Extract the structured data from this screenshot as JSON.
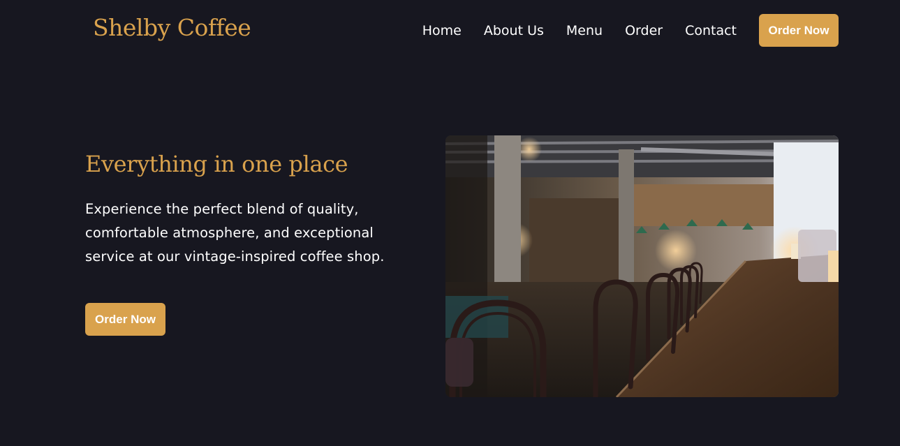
{
  "header": {
    "logo_text": "Shelby Coffee",
    "nav_items": [
      {
        "label": "Home"
      },
      {
        "label": "About Us"
      },
      {
        "label": "Menu"
      },
      {
        "label": "Order"
      },
      {
        "label": "Contact"
      }
    ],
    "cta_label": "Order Now"
  },
  "hero": {
    "title": "Everything in one place",
    "description": "Experience the perfect blend of quality, comfortable atmosphere, and exceptional service at our vintage-inspired coffee shop.",
    "cta_label": "Order Now"
  },
  "colors": {
    "background": "#171720",
    "accent": "#d9a24d",
    "text": "#ffffff"
  }
}
